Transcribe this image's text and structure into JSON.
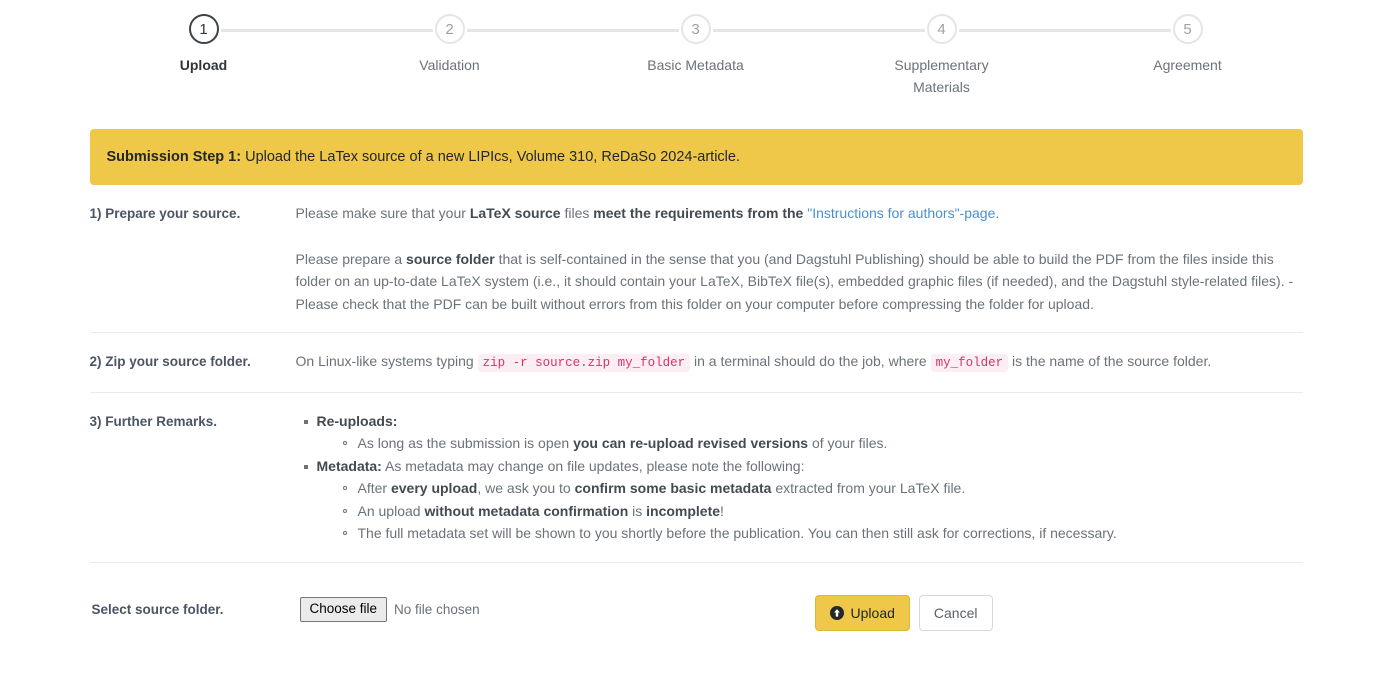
{
  "stepper": {
    "steps": [
      {
        "number": "1",
        "label": "Upload",
        "state": "active"
      },
      {
        "number": "2",
        "label": "Validation",
        "state": "inactive"
      },
      {
        "number": "3",
        "label": "Basic Metadata",
        "state": "inactive"
      },
      {
        "number": "4",
        "label": "Supplementary Materials",
        "state": "inactive"
      },
      {
        "number": "5",
        "label": "Agreement",
        "state": "inactive"
      }
    ]
  },
  "alert": {
    "strong": "Submission Step 1:",
    "text": " Upload the LaTex source of a new LIPIcs, Volume 310, ReDaSo 2024-article.",
    "background_color": "#efc84a"
  },
  "sections": {
    "prepare": {
      "label": "1) Prepare your source.",
      "p1_a": "Please make sure that your ",
      "p1_b": "LaTeX source",
      "p1_c": " files ",
      "p1_d": "meet the requirements from the ",
      "p1_link": "\"Instructions for authors\"-page",
      "p1_e": ".",
      "p2_a": "Please prepare a ",
      "p2_b": "source folder",
      "p2_c": " that is self-contained in the sense that you (and Dagstuhl Publishing) should be able to build the PDF from the files inside this folder on an up-to-date LaTeX system (i.e., it should contain your LaTeX, BibTeX file(s), embedded graphic files (if needed), and the Dagstuhl style-related files). - Please check that the PDF can be built without errors from this folder on your computer before compressing the folder for upload."
    },
    "zip": {
      "label": "2) Zip your source folder.",
      "text_a": "On Linux-like systems typing ",
      "code_1": "zip -r source.zip my_folder",
      "text_b": " in a terminal should do the job, where ",
      "code_2": "my_folder",
      "text_c": " is the name of the source folder."
    },
    "remarks": {
      "label": "3) Further Remarks.",
      "item1_strong": "Re-uploads:",
      "item1_sub1_a": "As long as the submission is open ",
      "item1_sub1_b": "you can re-upload revised versions",
      "item1_sub1_c": " of your files.",
      "item2_strong": "Metadata:",
      "item2_text": " As metadata may change on file updates, please note the following:",
      "item2_sub1_a": "After ",
      "item2_sub1_b": "every upload",
      "item2_sub1_c": ", we ask you to ",
      "item2_sub1_d": "confirm some basic metadata",
      "item2_sub1_e": " extracted from your LaTeX file.",
      "item2_sub2_a": "An upload ",
      "item2_sub2_b": "without metadata confirmation",
      "item2_sub2_c": " is ",
      "item2_sub2_d": "incomplete",
      "item2_sub2_e": "!",
      "item2_sub3": "The full metadata set will be shown to you shortly before the publication. You can then still ask for corrections, if necessary."
    }
  },
  "form": {
    "label": "Select source folder.",
    "choose_file_button": "Choose file",
    "file_status": "No file chosen",
    "upload_button": "Upload",
    "upload_icon": "upload-circle-arrow-icon",
    "cancel_button": "Cancel",
    "upload_button_color": "#efc84a"
  }
}
